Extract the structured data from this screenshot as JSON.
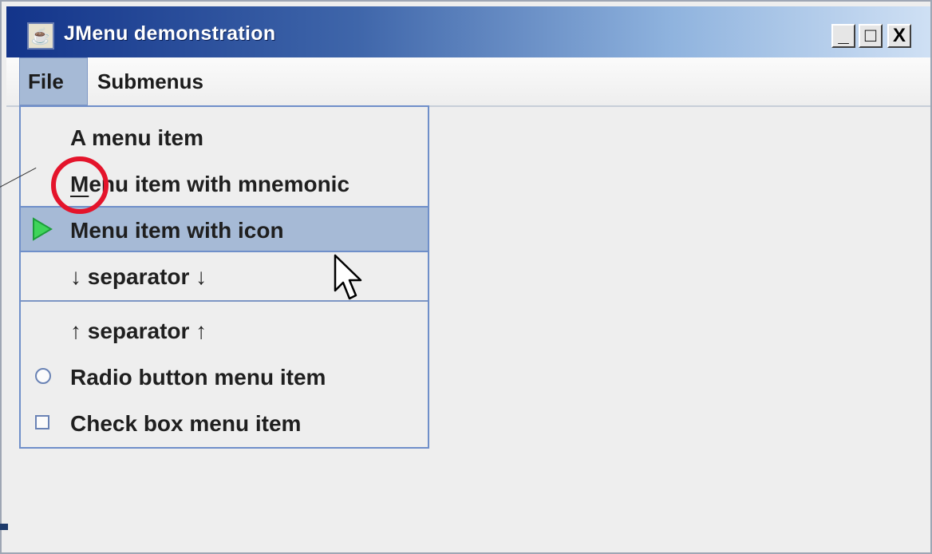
{
  "window": {
    "title": "JMenu demonstration",
    "controls": {
      "minimize": "_",
      "maximize": "□",
      "close": "X"
    }
  },
  "menubar": {
    "menus": [
      {
        "label": "File",
        "open": true
      },
      {
        "label": "Submenus",
        "open": false
      }
    ]
  },
  "file_menu": {
    "items": [
      {
        "type": "item",
        "label": "A menu item"
      },
      {
        "type": "item",
        "label": "Menu item with mnemonic",
        "mnemonic": "M"
      },
      {
        "type": "item",
        "label": "Menu item with icon",
        "icon": "play-icon",
        "selected": true
      },
      {
        "type": "item",
        "label": "↓ separator ↓"
      },
      {
        "type": "separator"
      },
      {
        "type": "item",
        "label": "↑ separator ↑"
      },
      {
        "type": "radio",
        "label": "Radio button menu item",
        "checked": false
      },
      {
        "type": "checkbox",
        "label": "Check box menu item",
        "checked": false
      }
    ]
  },
  "colors": {
    "selection": "#a6bad6",
    "menu_border": "#6f8fc9",
    "callout": "#e4142b",
    "play_icon": "#3fd45a"
  }
}
